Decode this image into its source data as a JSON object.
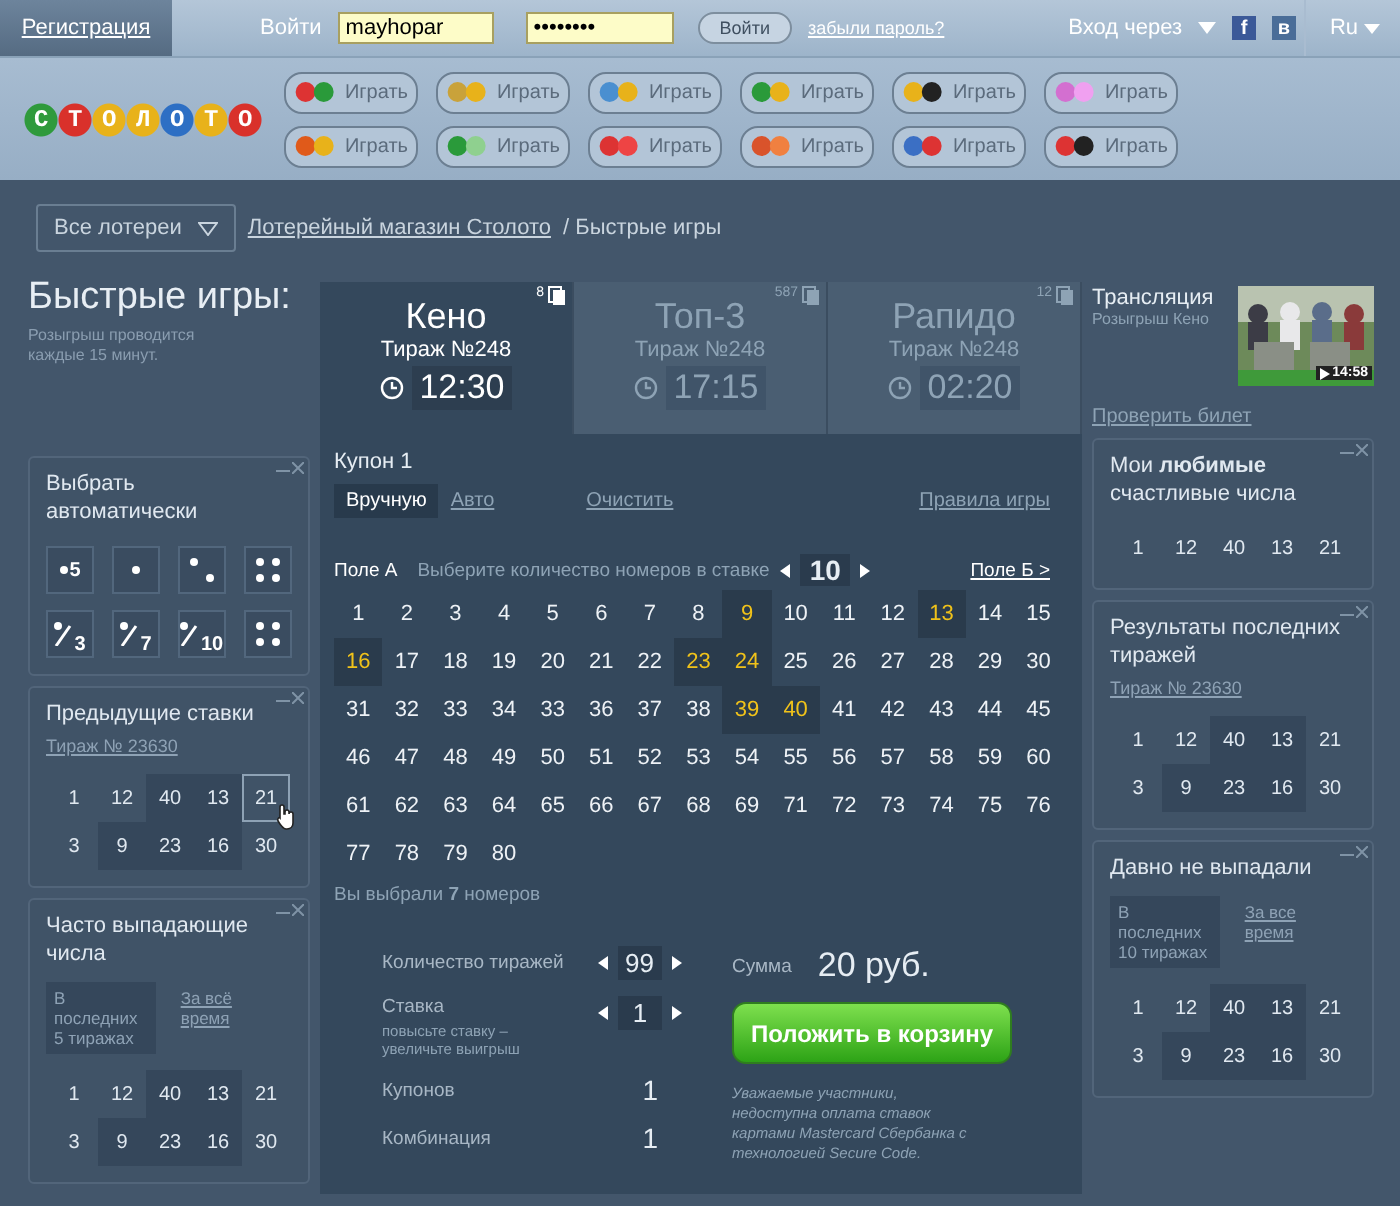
{
  "top_bar": {
    "register": "Регистрация",
    "login_label": "Войти",
    "login_value": "mayhopar",
    "password_value": "••••••••",
    "login_button": "Войти",
    "forgot": "забыли пароль?",
    "social_label": "Вход через",
    "social": [
      {
        "label": "f",
        "color": "#3b5998"
      },
      {
        "label": "в",
        "color": "#4a6d98"
      }
    ],
    "lang": "Ru"
  },
  "logo": "СТОЛОТО",
  "games": [
    {
      "play": "Играть"
    },
    {
      "play": "Играть"
    },
    {
      "play": "Играть"
    },
    {
      "play": "Играть"
    },
    {
      "play": "Играть"
    },
    {
      "play": "Играть"
    },
    {
      "play": "Играть"
    },
    {
      "play": "Играть"
    },
    {
      "play": "Играть"
    },
    {
      "play": "Играть"
    },
    {
      "play": "Играть"
    },
    {
      "play": "Играть"
    }
  ],
  "breadcrumb": {
    "filter": "Все лотереи",
    "link": "Лотерейный магазин Столото",
    "current": "/ Быстрые игры"
  },
  "left": {
    "title": "Быстрые игры:",
    "subtitle": "Розыгрыш проводится каждые 15 минут.",
    "auto_panel": {
      "title": "Выбрать автоматически",
      "buttons": [
        {
          "kind": "number",
          "text": "5"
        },
        {
          "kind": "one_dot"
        },
        {
          "kind": "two_dots"
        },
        {
          "kind": "four_dots"
        },
        {
          "kind": "fraction",
          "text": "3"
        },
        {
          "kind": "fraction",
          "text": "7"
        },
        {
          "kind": "fraction",
          "text": "10"
        },
        {
          "kind": "four_dots"
        }
      ]
    },
    "previous_panel": {
      "title": "Предыдущие ставки",
      "link": "Тираж № 23630",
      "cells": [
        {
          "n": "1",
          "highlighted": false,
          "hovered": false
        },
        {
          "n": "12",
          "highlighted": false,
          "hovered": false
        },
        {
          "n": "40",
          "highlighted": true,
          "hovered": false
        },
        {
          "n": "13",
          "highlighted": true,
          "hovered": false
        },
        {
          "n": "21",
          "highlighted": false,
          "hovered": true
        },
        {
          "n": "3",
          "highlighted": false,
          "hovered": false
        },
        {
          "n": "9",
          "highlighted": true,
          "hovered": false
        },
        {
          "n": "23",
          "highlighted": true,
          "hovered": false
        },
        {
          "n": "16",
          "highlighted": true,
          "hovered": false
        },
        {
          "n": "30",
          "highlighted": false,
          "hovered": false
        }
      ]
    },
    "frequent_panel": {
      "title": "Часто выпадающие числа",
      "tabs": [
        {
          "label": "В последних 5 тиражах",
          "selected": true
        },
        {
          "label": "За всё время",
          "selected": false
        }
      ],
      "cells": [
        {
          "n": "1",
          "highlighted": false
        },
        {
          "n": "12",
          "highlighted": false
        },
        {
          "n": "40",
          "highlighted": true
        },
        {
          "n": "13",
          "highlighted": true
        },
        {
          "n": "21",
          "highlighted": false
        },
        {
          "n": "3",
          "highlighted": false
        },
        {
          "n": "9",
          "highlighted": true
        },
        {
          "n": "23",
          "highlighted": true
        },
        {
          "n": "16",
          "highlighted": true
        },
        {
          "n": "30",
          "highlighted": false
        }
      ]
    }
  },
  "center": {
    "game_tabs": [
      {
        "name": "Кено",
        "draw": "Тираж №248",
        "time": "12:30",
        "count": "8",
        "selected": true
      },
      {
        "name": "Топ-3",
        "draw": "Тираж №248",
        "time": "17:15",
        "count": "587",
        "selected": false
      },
      {
        "name": "Рапидо",
        "draw": "Тираж №248",
        "time": "02:20",
        "count": "12",
        "selected": false
      }
    ],
    "coupon": "Купон  1",
    "modes": [
      {
        "label": "Вручную",
        "selected": true
      },
      {
        "label": "Авто",
        "selected": false
      }
    ],
    "clear": "Очистить",
    "rules": "Правила игры",
    "field_a": "Поле А",
    "hint": "Выберите количество номеров в ставке",
    "count": "10",
    "field_b": "Поле Б >",
    "numbers": [
      {
        "n": "1",
        "selected": false
      },
      {
        "n": "2",
        "selected": false
      },
      {
        "n": "3",
        "selected": false
      },
      {
        "n": "4",
        "selected": false
      },
      {
        "n": "5",
        "selected": false
      },
      {
        "n": "6",
        "selected": false
      },
      {
        "n": "7",
        "selected": false
      },
      {
        "n": "8",
        "selected": false
      },
      {
        "n": "9",
        "selected": true
      },
      {
        "n": "10",
        "selected": false
      },
      {
        "n": "11",
        "selected": false
      },
      {
        "n": "12",
        "selected": false
      },
      {
        "n": "13",
        "selected": true
      },
      {
        "n": "14",
        "selected": false
      },
      {
        "n": "15",
        "selected": false
      },
      {
        "n": "16",
        "selected": true
      },
      {
        "n": "17",
        "selected": false
      },
      {
        "n": "18",
        "selected": false
      },
      {
        "n": "19",
        "selected": false
      },
      {
        "n": "20",
        "selected": false
      },
      {
        "n": "21",
        "selected": false
      },
      {
        "n": "22",
        "selected": false
      },
      {
        "n": "23",
        "selected": true
      },
      {
        "n": "24",
        "selected": true
      },
      {
        "n": "25",
        "selected": false
      },
      {
        "n": "26",
        "selected": false
      },
      {
        "n": "27",
        "selected": false
      },
      {
        "n": "28",
        "selected": false
      },
      {
        "n": "29",
        "selected": false
      },
      {
        "n": "30",
        "selected": false
      },
      {
        "n": "31",
        "selected": false
      },
      {
        "n": "32",
        "selected": false
      },
      {
        "n": "33",
        "selected": false
      },
      {
        "n": "34",
        "selected": false
      },
      {
        "n": "33",
        "selected": false
      },
      {
        "n": "36",
        "selected": false
      },
      {
        "n": "37",
        "selected": false
      },
      {
        "n": "38",
        "selected": false
      },
      {
        "n": "39",
        "selected": true
      },
      {
        "n": "40",
        "selected": true
      },
      {
        "n": "41",
        "selected": false
      },
      {
        "n": "42",
        "selected": false
      },
      {
        "n": "43",
        "selected": false
      },
      {
        "n": "44",
        "selected": false
      },
      {
        "n": "45",
        "selected": false
      },
      {
        "n": "46",
        "selected": false
      },
      {
        "n": "47",
        "selected": false
      },
      {
        "n": "48",
        "selected": false
      },
      {
        "n": "49",
        "selected": false
      },
      {
        "n": "50",
        "selected": false
      },
      {
        "n": "51",
        "selected": false
      },
      {
        "n": "52",
        "selected": false
      },
      {
        "n": "53",
        "selected": false
      },
      {
        "n": "54",
        "selected": false
      },
      {
        "n": "55",
        "selected": false
      },
      {
        "n": "56",
        "selected": false
      },
      {
        "n": "57",
        "selected": false
      },
      {
        "n": "58",
        "selected": false
      },
      {
        "n": "59",
        "selected": false
      },
      {
        "n": "60",
        "selected": false
      },
      {
        "n": "61",
        "selected": false
      },
      {
        "n": "62",
        "selected": false
      },
      {
        "n": "63",
        "selected": false
      },
      {
        "n": "64",
        "selected": false
      },
      {
        "n": "65",
        "selected": false
      },
      {
        "n": "66",
        "selected": false
      },
      {
        "n": "67",
        "selected": false
      },
      {
        "n": "68",
        "selected": false
      },
      {
        "n": "69",
        "selected": false
      },
      {
        "n": "71",
        "selected": false
      },
      {
        "n": "72",
        "selected": false
      },
      {
        "n": "73",
        "selected": false
      },
      {
        "n": "74",
        "selected": false
      },
      {
        "n": "75",
        "selected": false
      },
      {
        "n": "76",
        "selected": false
      },
      {
        "n": "77",
        "selected": false
      },
      {
        "n": "78",
        "selected": false
      },
      {
        "n": "79",
        "selected": false
      },
      {
        "n": "80",
        "selected": false
      }
    ],
    "summary": "Вы выбрали **7** номеров",
    "draws_label": "Количество тиражей",
    "draws": "99",
    "stake_label": "Ставка",
    "stake_hint": "повысьте ставку – увеличьте выигрыш",
    "stake": "1",
    "coupons_label": "Купонов",
    "coupons": "1",
    "combos_label": "Комбинация",
    "combos": "1",
    "sum_label": "Сумма",
    "sum": "20 руб.",
    "cart_button": "Положить в корзину",
    "notice": "Уважаемые участники, недоступна оплата ставок картами Mastercard Сбербанка с технологией Secure Code."
  },
  "right": {
    "broadcast_title": "Трансляция",
    "broadcast_subtitle": "Розыгрыш Кено",
    "video_duration": "14:58",
    "check_ticket": "Проверить билет",
    "favorites_panel": {
      "title": "Мои **любимые** счастливые числа",
      "cells": [
        {
          "n": "1",
          "highlighted": false
        },
        {
          "n": "12",
          "highlighted": false
        },
        {
          "n": "40",
          "highlighted": false
        },
        {
          "n": "13",
          "highlighted": false
        },
        {
          "n": "21",
          "highlighted": false
        }
      ]
    },
    "results_panel": {
      "title": "Результаты последних тиражей",
      "link": "Тираж № 23630",
      "cells": [
        {
          "n": "1",
          "highlighted": false
        },
        {
          "n": "12",
          "highlighted": false
        },
        {
          "n": "40",
          "highlighted": true
        },
        {
          "n": "13",
          "highlighted": true
        },
        {
          "n": "21",
          "highlighted": false
        },
        {
          "n": "3",
          "highlighted": false
        },
        {
          "n": "9",
          "highlighted": true
        },
        {
          "n": "23",
          "highlighted": true
        },
        {
          "n": "16",
          "highlighted": true
        },
        {
          "n": "30",
          "highlighted": false
        }
      ]
    },
    "absent_panel": {
      "title": "Давно не выпадали",
      "tabs": [
        {
          "label": "В последних 10 тиражах",
          "selected": true
        },
        {
          "label": "За все время",
          "selected": false
        }
      ],
      "cells": [
        {
          "n": "1",
          "highlighted": false
        },
        {
          "n": "12",
          "highlighted": false
        },
        {
          "n": "40",
          "highlighted": true
        },
        {
          "n": "13",
          "highlighted": true
        },
        {
          "n": "21",
          "highlighted": false
        },
        {
          "n": "3",
          "highlighted": false
        },
        {
          "n": "9",
          "highlighted": true
        },
        {
          "n": "23",
          "highlighted": true
        },
        {
          "n": "16",
          "highlighted": true
        },
        {
          "n": "30",
          "highlighted": false
        }
      ]
    }
  }
}
